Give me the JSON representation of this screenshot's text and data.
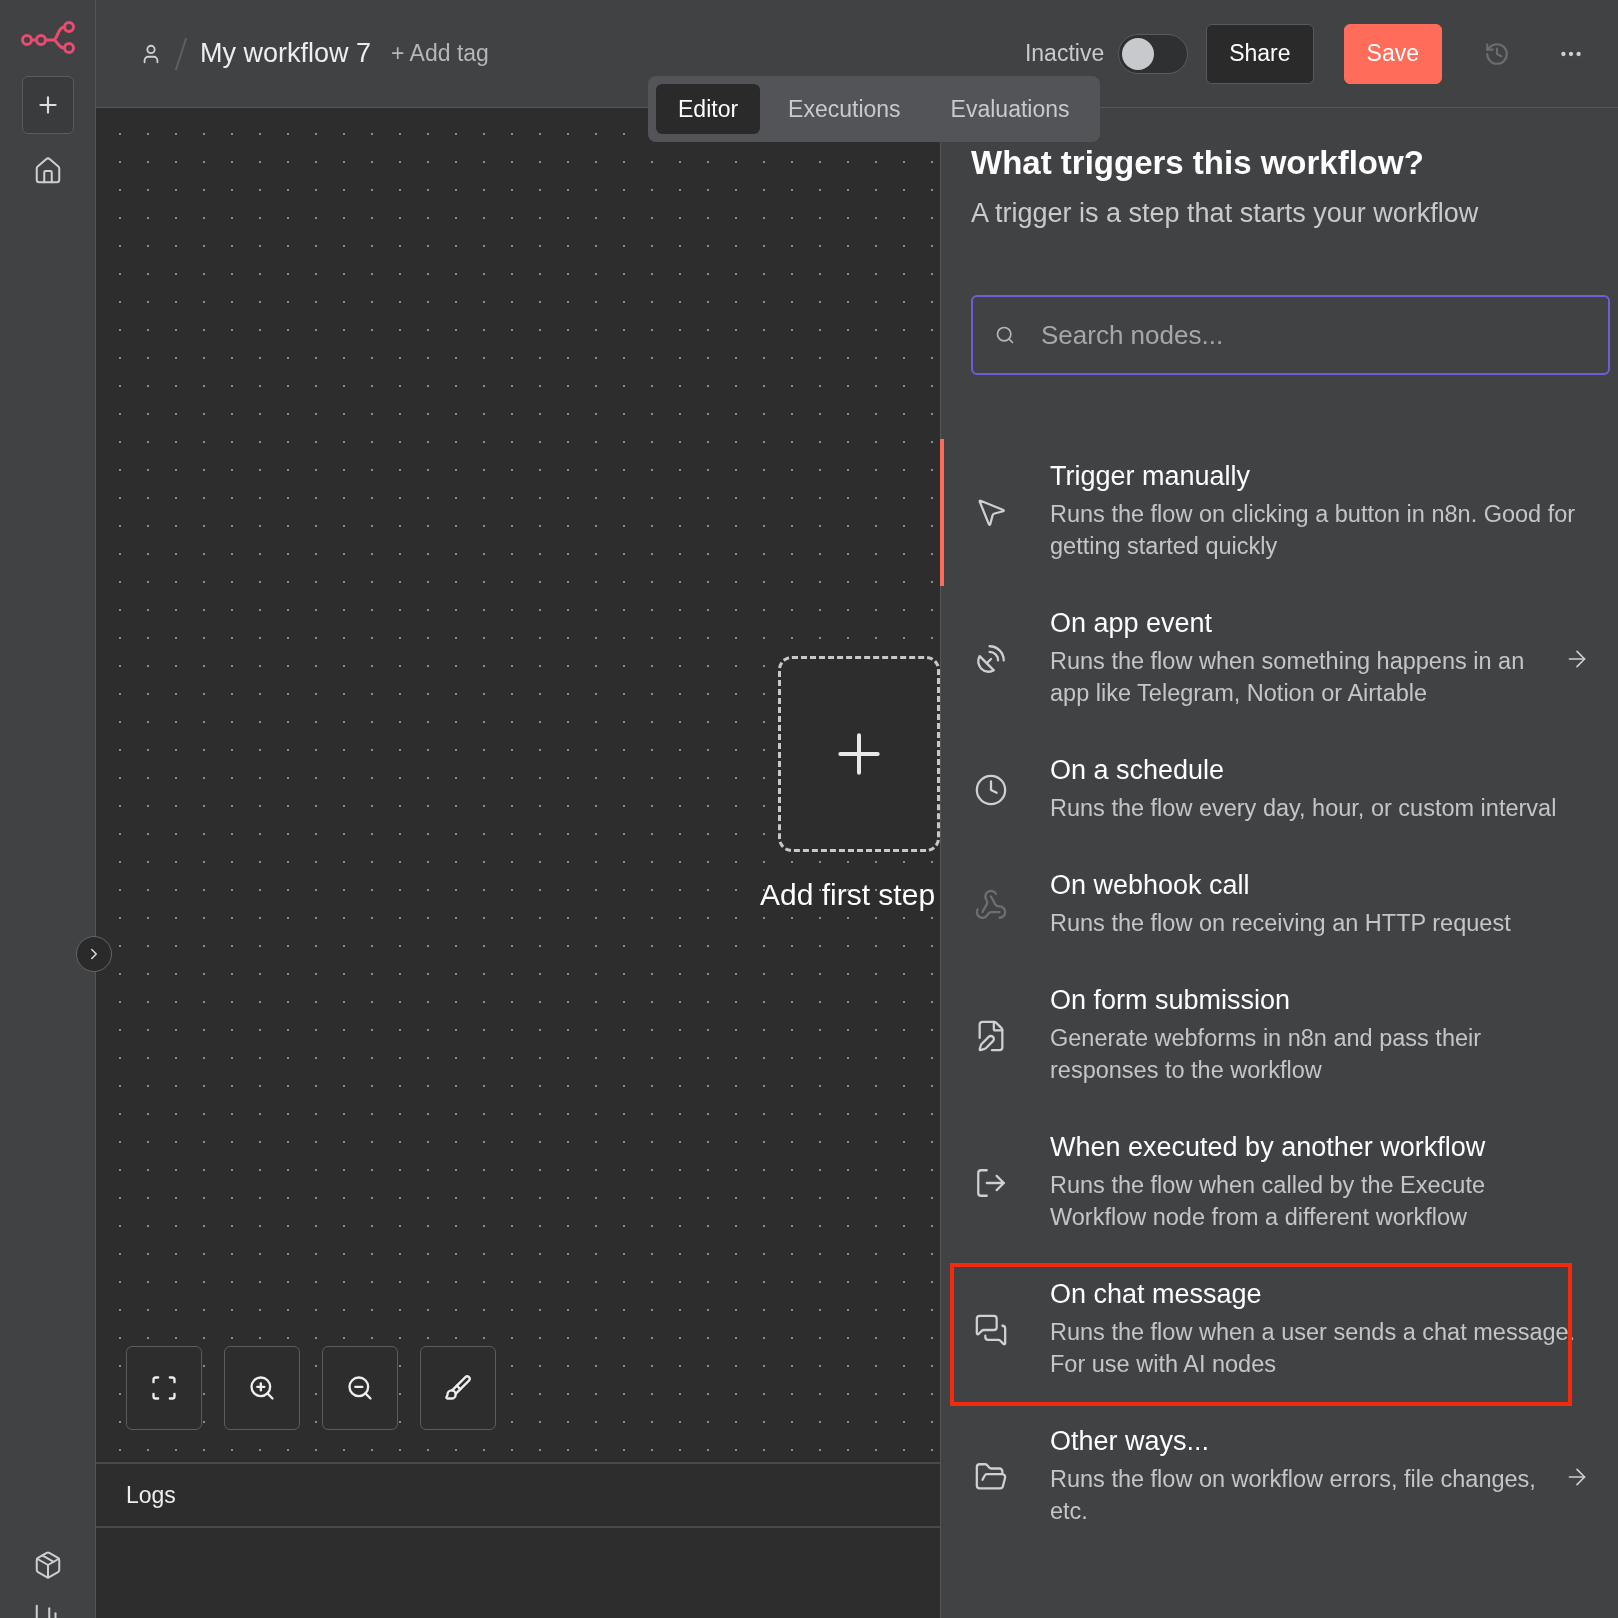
{
  "header": {
    "breadcrumb": "My workflow 7",
    "add_tag": "+ Add tag",
    "status_label": "Inactive",
    "active_toggle": {
      "on": false
    },
    "share": "Share",
    "save": "Save"
  },
  "tabs": [
    {
      "label": "Editor",
      "selected": true
    },
    {
      "label": "Executions",
      "selected": false
    },
    {
      "label": "Evaluations",
      "selected": false
    }
  ],
  "canvas": {
    "add_first_step": "Add first step",
    "logs": "Logs"
  },
  "panel": {
    "title": "What triggers this workflow?",
    "subtitle": "A trigger is a step that starts your workflow",
    "search": {
      "placeholder": "Search nodes..."
    },
    "items": [
      {
        "title": "Trigger manually",
        "description": "Runs the flow on clicking a button in n8n. Good for getting started quickly",
        "selected": true,
        "has_submenu": false,
        "highlighted": false
      },
      {
        "title": "On app event",
        "description": "Runs the flow when something happens in an app like Telegram, Notion or Airtable",
        "selected": false,
        "has_submenu": true,
        "highlighted": false
      },
      {
        "title": "On a schedule",
        "description": "Runs the flow every day, hour, or custom interval",
        "selected": false,
        "has_submenu": false,
        "highlighted": false
      },
      {
        "title": "On webhook call",
        "description": "Runs the flow on receiving an HTTP request",
        "selected": false,
        "has_submenu": false,
        "highlighted": false
      },
      {
        "title": "On form submission",
        "description": "Generate webforms in n8n and pass their responses to the workflow",
        "selected": false,
        "has_submenu": false,
        "highlighted": false
      },
      {
        "title": "When executed by another workflow",
        "description": "Runs the flow when called by the Execute Workflow node from a different workflow",
        "selected": false,
        "has_submenu": false,
        "highlighted": false
      },
      {
        "title": "On chat message",
        "description": "Runs the flow when a user sends a chat message. For use with AI nodes",
        "selected": false,
        "has_submenu": false,
        "highlighted": true
      },
      {
        "title": "Other ways...",
        "description": "Runs the flow on workflow errors, file changes, etc.",
        "selected": false,
        "has_submenu": true,
        "highlighted": false
      }
    ]
  }
}
